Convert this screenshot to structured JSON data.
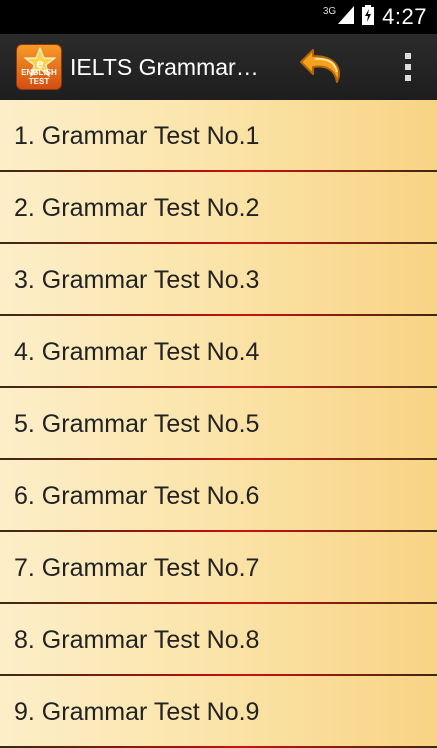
{
  "status_bar": {
    "network": "3G",
    "time": "4:27",
    "icons": [
      "signal-icon",
      "battery-charging-icon"
    ]
  },
  "action_bar": {
    "app_icon": "english-test-logo",
    "app_icon_text_line1": "ENGLISH",
    "app_icon_text_line2": "TEST",
    "title": "IELTS Grammar…",
    "back_icon": "undo-arrow-icon",
    "overflow_icon": "overflow-menu-icon",
    "colors": {
      "bar": "#222222",
      "arrow": "#f4a21c"
    }
  },
  "list": {
    "items": [
      {
        "label": "1. Grammar Test No.1"
      },
      {
        "label": "2. Grammar Test No.2"
      },
      {
        "label": "3. Grammar Test No.3"
      },
      {
        "label": "4. Grammar Test No.4"
      },
      {
        "label": "5. Grammar Test No.5"
      },
      {
        "label": "6. Grammar Test No.6"
      },
      {
        "label": "7. Grammar Test No.7"
      },
      {
        "label": "8. Grammar Test No.8"
      },
      {
        "label": "9. Grammar Test No.9"
      }
    ],
    "colors": {
      "background": "#fbe4a9",
      "divider": "#c01010"
    }
  }
}
